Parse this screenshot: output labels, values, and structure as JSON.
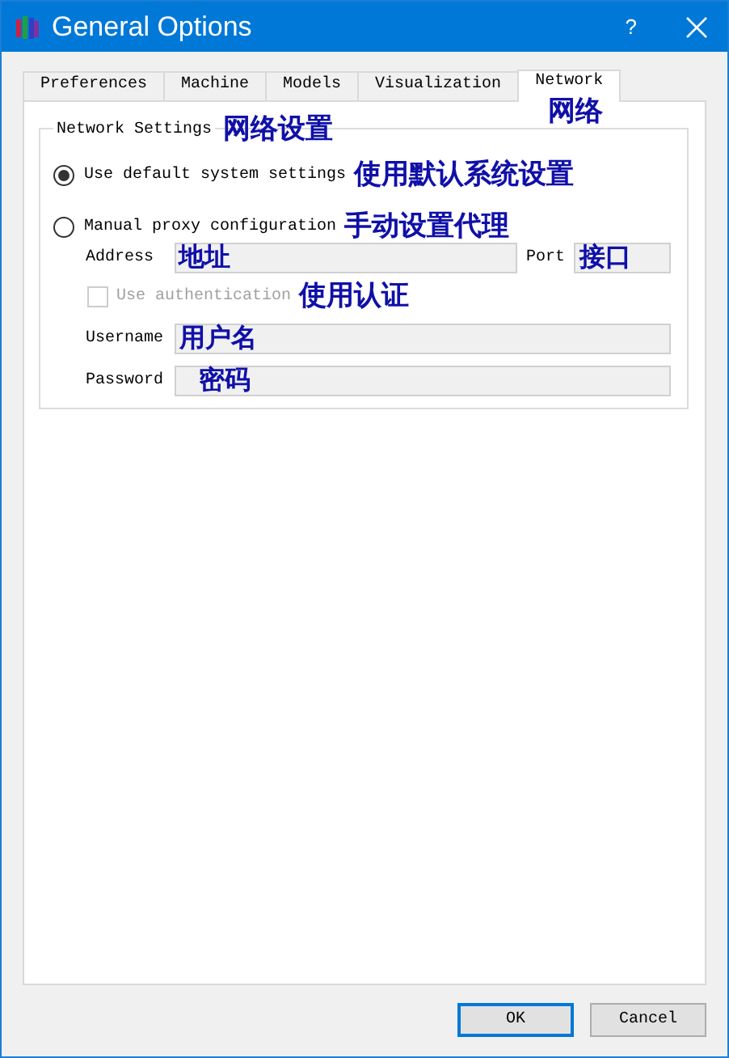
{
  "window": {
    "title": "General Options",
    "help": "?"
  },
  "tabs": [
    {
      "label": "Preferences",
      "selected": false
    },
    {
      "label": "Machine",
      "selected": false
    },
    {
      "label": "Models",
      "selected": false
    },
    {
      "label": "Visualization",
      "selected": false
    },
    {
      "label": "Network",
      "selected": true,
      "note": "网络"
    }
  ],
  "network_settings": {
    "title": "Network Settings",
    "note": "网络设置",
    "options": [
      {
        "label": "Use default system settings",
        "selected": true,
        "note": "使用默认系统设置"
      },
      {
        "label": "Manual proxy configuration",
        "selected": false,
        "note": "手动设置代理"
      }
    ],
    "address": {
      "label": "Address",
      "note": "地址"
    },
    "port": {
      "label": "Port",
      "note": "接口"
    },
    "authentication": {
      "label": "Use authentication",
      "checked": false,
      "disabled": true,
      "note": "使用认证"
    },
    "username": {
      "label": "Username",
      "note": "用户名"
    },
    "password": {
      "label": "Password",
      "note": "密码"
    }
  },
  "buttons": [
    {
      "label": "OK",
      "default": true
    },
    {
      "label": "Cancel",
      "default": false
    }
  ]
}
